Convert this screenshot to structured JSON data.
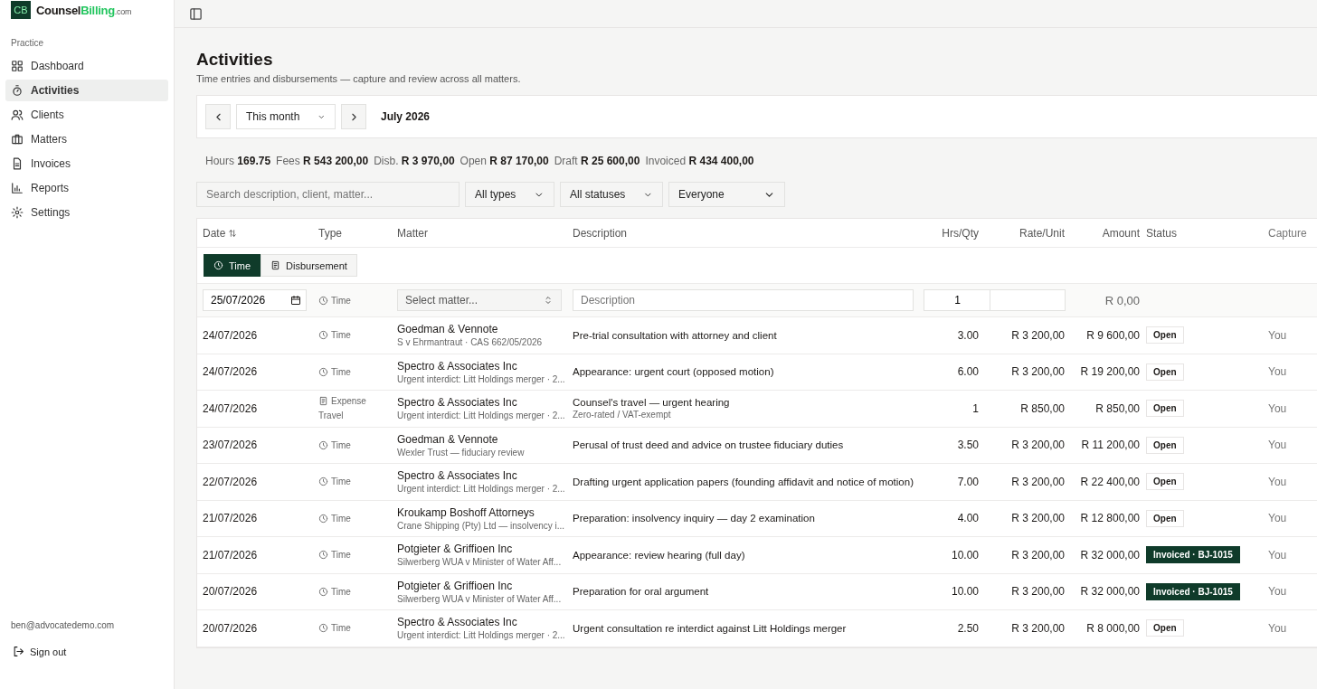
{
  "brand": {
    "mark": "CB",
    "name": "Counsel",
    "name_accent": "Billing",
    "suffix": ".com"
  },
  "sidebar": {
    "section": "Practice",
    "items": [
      {
        "label": "Dashboard",
        "selected": false
      },
      {
        "label": "Activities",
        "selected": true
      },
      {
        "label": "Clients",
        "selected": false
      },
      {
        "label": "Matters",
        "selected": false
      },
      {
        "label": "Invoices",
        "selected": false
      },
      {
        "label": "Reports",
        "selected": false
      },
      {
        "label": "Settings",
        "selected": false
      }
    ],
    "user_email": "ben@advocatedemo.com",
    "sign_out": "Sign out"
  },
  "page": {
    "title": "Activities",
    "subtitle": "Time entries and disbursements — capture and review across all matters."
  },
  "period": {
    "range": "This month",
    "label": "July 2026"
  },
  "stats": [
    {
      "label": "Hours",
      "value": "169.75"
    },
    {
      "label": "Fees",
      "value": "R 543 200,00"
    },
    {
      "label": "Disb.",
      "value": "R 3 970,00"
    },
    {
      "label": "Open",
      "value": "R 87 170,00"
    },
    {
      "label": "Draft",
      "value": "R 25 600,00"
    },
    {
      "label": "Invoiced",
      "value": "R 434 400,00"
    }
  ],
  "filters": {
    "search_placeholder": "Search description, client, matter...",
    "type": "All types",
    "status": "All statuses",
    "person": "Everyone"
  },
  "table": {
    "columns": [
      "Date",
      "Type",
      "Matter",
      "Description",
      "Hrs/Qty",
      "Rate/Unit",
      "Amount",
      "Status",
      "Capture"
    ],
    "entry_modes": [
      {
        "kind": "time",
        "label": "Time",
        "selected": true
      },
      {
        "kind": "expense",
        "label": "Disbursement",
        "selected": false
      }
    ],
    "new_entry": {
      "date": "25/07/2026",
      "type": "Time",
      "matter_placeholder": "Select matter...",
      "description_placeholder": "Description",
      "qty": "1",
      "amount": "R 0,00"
    },
    "rows": [
      {
        "date": "24/07/2026",
        "type": {
          "kind": "time",
          "label": "Time"
        },
        "client": "Goedman & Vennote",
        "matter": "S v Ehrmantraut · CAS 662/05/2026",
        "description": "Pre-trial consultation with attorney and client",
        "qty": "3.00",
        "rate": "R 3 200,00",
        "amount": "R 9 600,00",
        "status": {
          "kind": "open",
          "label": "Open"
        },
        "captured": "You"
      },
      {
        "date": "24/07/2026",
        "type": {
          "kind": "time",
          "label": "Time"
        },
        "client": "Spectro & Associates Inc",
        "matter": "Urgent interdict: Litt Holdings merger · 2...",
        "description": "Appearance: urgent court (opposed motion)",
        "qty": "6.00",
        "rate": "R 3 200,00",
        "amount": "R 19 200,00",
        "status": {
          "kind": "open",
          "label": "Open"
        },
        "captured": "You"
      },
      {
        "date": "24/07/2026",
        "type": {
          "kind": "expense",
          "label": "Expense",
          "sub": "Travel"
        },
        "client": "Spectro & Associates Inc",
        "matter": "Urgent interdict: Litt Holdings merger · 2...",
        "description": "Counsel's travel — urgent hearing",
        "note": "Zero-rated / VAT-exempt",
        "qty": "1",
        "rate": "R 850,00",
        "amount": "R 850,00",
        "status": {
          "kind": "open",
          "label": "Open"
        },
        "captured": "You"
      },
      {
        "date": "23/07/2026",
        "type": {
          "kind": "time",
          "label": "Time"
        },
        "client": "Goedman & Vennote",
        "matter": "Wexler Trust — fiduciary review",
        "description": "Perusal of trust deed and advice on trustee fiduciary duties",
        "qty": "3.50",
        "rate": "R 3 200,00",
        "amount": "R 11 200,00",
        "status": {
          "kind": "open",
          "label": "Open"
        },
        "captured": "You"
      },
      {
        "date": "22/07/2026",
        "type": {
          "kind": "time",
          "label": "Time"
        },
        "client": "Spectro & Associates Inc",
        "matter": "Urgent interdict: Litt Holdings merger · 2...",
        "description": "Drafting urgent application papers (founding affidavit and notice of motion)",
        "qty": "7.00",
        "rate": "R 3 200,00",
        "amount": "R 22 400,00",
        "status": {
          "kind": "open",
          "label": "Open"
        },
        "captured": "You"
      },
      {
        "date": "21/07/2026",
        "type": {
          "kind": "time",
          "label": "Time"
        },
        "client": "Kroukamp Boshoff Attorneys",
        "matter": "Crane Shipping (Pty) Ltd — insolvency i...",
        "description": "Preparation: insolvency inquiry — day 2 examination",
        "qty": "4.00",
        "rate": "R 3 200,00",
        "amount": "R 12 800,00",
        "status": {
          "kind": "open",
          "label": "Open"
        },
        "captured": "You"
      },
      {
        "date": "21/07/2026",
        "type": {
          "kind": "time",
          "label": "Time"
        },
        "client": "Potgieter & Griffioen Inc",
        "matter": "Silwerberg WUA v Minister of Water Aff...",
        "description": "Appearance: review hearing (full day)",
        "qty": "10.00",
        "rate": "R 3 200,00",
        "amount": "R 32 000,00",
        "status": {
          "kind": "invoiced",
          "label": "Invoiced · BJ-1015"
        },
        "captured": "You"
      },
      {
        "date": "20/07/2026",
        "type": {
          "kind": "time",
          "label": "Time"
        },
        "client": "Potgieter & Griffioen Inc",
        "matter": "Silwerberg WUA v Minister of Water Aff...",
        "description": "Preparation for oral argument",
        "qty": "10.00",
        "rate": "R 3 200,00",
        "amount": "R 32 000,00",
        "status": {
          "kind": "invoiced",
          "label": "Invoiced · BJ-1015"
        },
        "captured": "You"
      },
      {
        "date": "20/07/2026",
        "type": {
          "kind": "time",
          "label": "Time"
        },
        "client": "Spectro & Associates Inc",
        "matter": "Urgent interdict: Litt Holdings merger · 2...",
        "description": "Urgent consultation re interdict against Litt Holdings merger",
        "qty": "2.50",
        "rate": "R 3 200,00",
        "amount": "R 8 000,00",
        "status": {
          "kind": "open",
          "label": "Open"
        },
        "captured": "You"
      }
    ]
  }
}
